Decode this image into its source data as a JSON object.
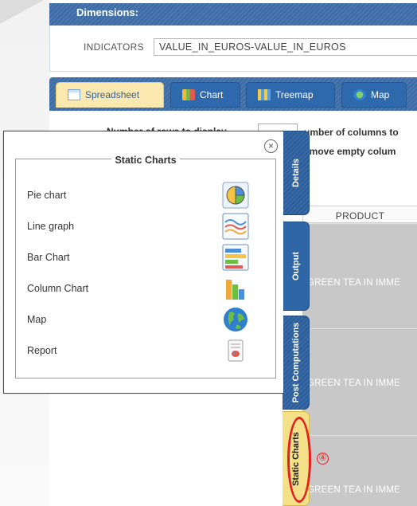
{
  "dimensions": {
    "header": "Dimensions:",
    "indicators_label": "INDICATORS",
    "indicators_value": "VALUE_IN_EUROS-VALUE_IN_EUROS"
  },
  "tabs": [
    {
      "label": "Spreadsheet",
      "icon": "spreadsheet-icon",
      "active": true
    },
    {
      "label": "Chart",
      "icon": "chart-icon",
      "active": false
    },
    {
      "label": "Treemap",
      "icon": "treemap-icon",
      "active": false
    },
    {
      "label": "Map",
      "icon": "globe-icon",
      "active": false
    }
  ],
  "options": {
    "rows_label": "Number of rows to display",
    "columns_label": "umber of columns to",
    "remove_empty_label": "emove empty colum"
  },
  "table": {
    "header": "PRODUCT",
    "rows": [
      "GREEN TEA IN IMME",
      "GREEN TEA IN IMME",
      "GREEN TEA IN IMME"
    ]
  },
  "side_tabs": [
    {
      "label": "Details"
    },
    {
      "label": "Output"
    },
    {
      "label": "Post Computations"
    },
    {
      "label": "Static Charts",
      "active": true
    }
  ],
  "annotation": {
    "step": "④",
    "color": "#e02020"
  },
  "popup": {
    "title": "Static Charts",
    "close": "×",
    "items": [
      {
        "label": "Pie chart",
        "icon": "pie-chart-icon"
      },
      {
        "label": "Line graph",
        "icon": "line-graph-icon"
      },
      {
        "label": "Bar Chart",
        "icon": "bar-chart-icon"
      },
      {
        "label": "Column Chart",
        "icon": "column-chart-icon"
      },
      {
        "label": "Map",
        "icon": "globe-icon"
      },
      {
        "label": "Report",
        "icon": "report-icon"
      }
    ]
  },
  "colors": {
    "accent_blue": "#3c6aa1",
    "active_tab": "#fbe9b0",
    "highlight": "#e02020"
  }
}
